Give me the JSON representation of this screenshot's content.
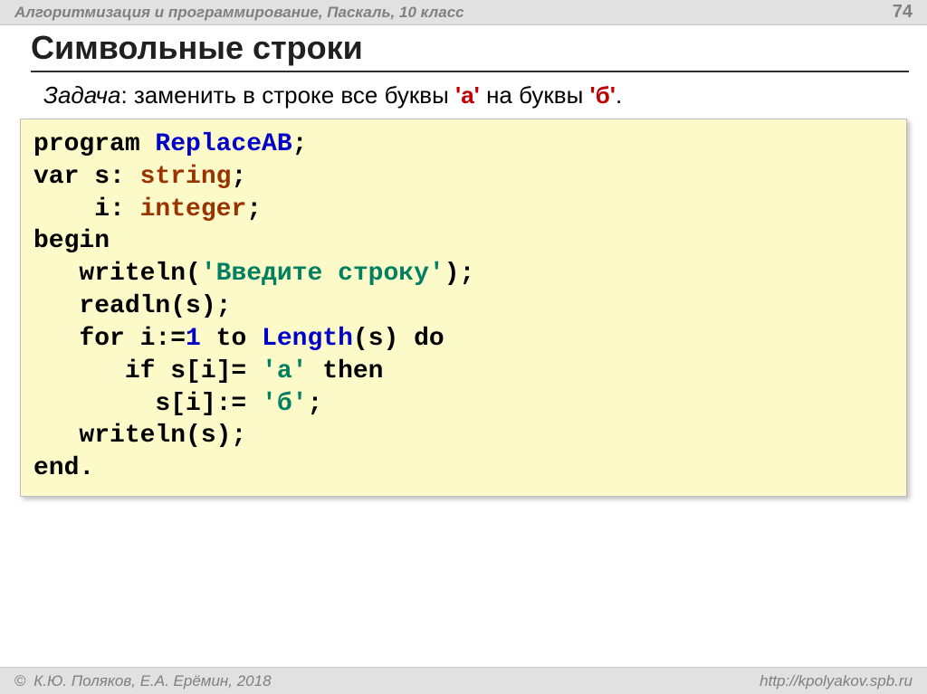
{
  "header": {
    "course": "Алгоритмизация и программирование, Паскаль, 10 класс",
    "page": "74"
  },
  "title": "Символьные строки",
  "task": {
    "label": "Задача",
    "sep": ": ",
    "t1": "заменить в строке все буквы ",
    "c1": "'а'",
    "t2": " на буквы ",
    "c2": "'б'",
    "t3": "."
  },
  "code": {
    "l1a": "program ",
    "l1b": "ReplaceAB",
    "l1c": ";",
    "l2a": "var s: ",
    "l2b": "string",
    "l2c": ";",
    "l3a": "    i: ",
    "l3b": "integer",
    "l3c": ";",
    "l4": "begin",
    "l5a": "   writeln(",
    "l5b": "'Введите строку'",
    "l5c": ");",
    "l6": "   readln(s);",
    "l7a": "   for i:=",
    "l7b": "1",
    "l7c": " to ",
    "l7d": "Length",
    "l7e": "(s) do",
    "l8a": "      if s[i]= ",
    "l8b": "'а'",
    "l8c": " then",
    "l9a": "        s[i]:= ",
    "l9b": "'б'",
    "l9c": ";",
    "l10": "   writeln(s);",
    "l11": "end."
  },
  "footer": {
    "copyright": " К.Ю. Поляков, Е.А. Ерёмин, 2018",
    "url": "http://kpolyakov.spb.ru"
  }
}
